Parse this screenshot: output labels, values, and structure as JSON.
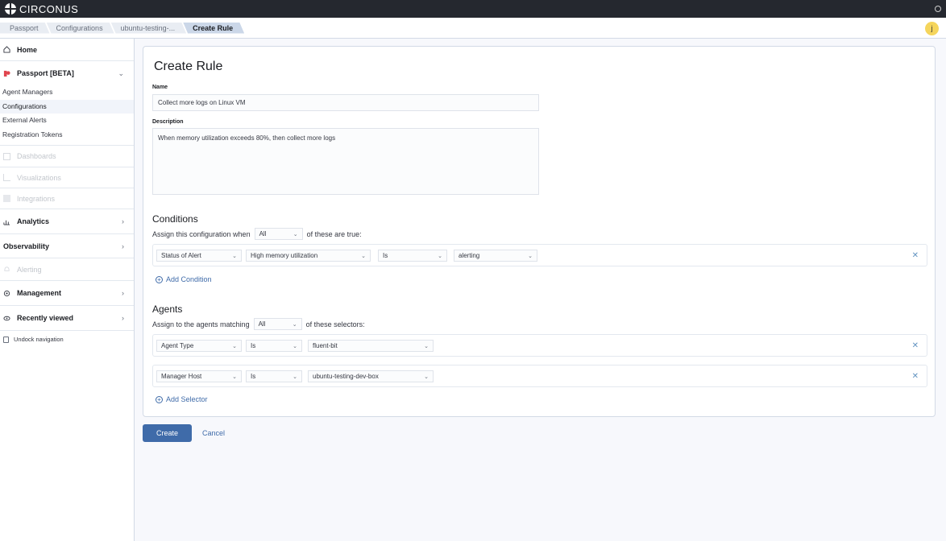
{
  "app": {
    "brand": "CIRCONUS",
    "user_initial": "j"
  },
  "breadcrumbs": [
    "Passport",
    "Configurations",
    "ubuntu-testing-...",
    "Create Rule"
  ],
  "sidebar": {
    "home": "Home",
    "passport": "Passport [BETA]",
    "passport_items": [
      "Agent Managers",
      "Configurations",
      "External Alerts",
      "Registration Tokens"
    ],
    "dashboards": "Dashboards",
    "visualizations": "Visualizations",
    "integrations": "Integrations",
    "analytics": "Analytics",
    "observability": "Observability",
    "alerting": "Alerting",
    "management": "Management",
    "recently_viewed": "Recently viewed",
    "undock": "Undock navigation"
  },
  "form": {
    "title": "Create Rule",
    "name_label": "Name",
    "name_value": "Collect more logs on Linux VM",
    "description_label": "Description",
    "description_value": "When memory utilization exceeds 80%, then collect more logs",
    "conditions": {
      "heading": "Conditions",
      "prefix": "Assign this configuration when",
      "match": "All",
      "suffix": "of these are true:",
      "rows": [
        {
          "field": "Status of Alert",
          "value": "High memory utilization",
          "operator": "Is",
          "state": "alerting"
        }
      ],
      "add_label": "Add Condition"
    },
    "agents": {
      "heading": "Agents",
      "prefix": "Assign to the agents matching",
      "match": "All",
      "suffix": "of these selectors:",
      "rows": [
        {
          "field": "Agent Type",
          "operator": "Is",
          "value": "fluent-bit"
        },
        {
          "field": "Manager Host",
          "operator": "Is",
          "value": "ubuntu-testing-dev-box"
        }
      ],
      "add_label": "Add Selector"
    },
    "create_label": "Create",
    "cancel_label": "Cancel"
  },
  "colors": {
    "accent": "#3f6ba9",
    "topbar": "#25282f",
    "avatar": "#f5d55c"
  }
}
